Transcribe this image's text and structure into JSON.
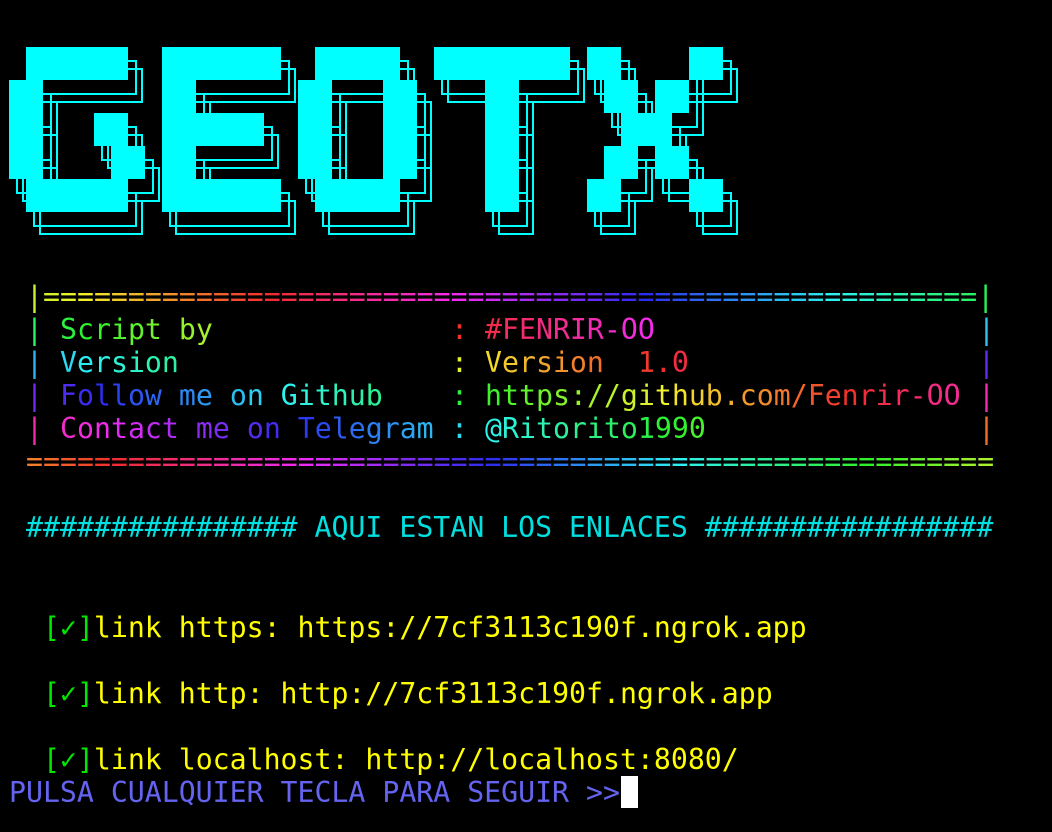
{
  "logo": {
    "text": "GEOTX",
    "color": "#00FFFF"
  },
  "box": {
    "border_top": "|=======================================================|",
    "border_bottom": "=========================================================",
    "side": "|",
    "colon": ":",
    "rows": [
      {
        "label": "Script by",
        "value": "#FENRIR-OO"
      },
      {
        "label": "Version",
        "value": "Version  1.0"
      },
      {
        "label": "Follow me on Github",
        "value": "https://github.com/Fenrir-OO"
      },
      {
        "label": "Contact me on Telegram",
        "value": "@Ritorito1990"
      }
    ]
  },
  "header": "################ AQUI ESTAN LOS ENLACES #################",
  "links": [
    {
      "mark": "[✓]",
      "text": "link https: https://7cf3113c190f.ngrok.app"
    },
    {
      "mark": "[✓]",
      "text": "link http: http://7cf3113c190f.ngrok.app"
    },
    {
      "mark": "[✓]",
      "text": "link localhost: http://localhost:8080/"
    }
  ],
  "prompt": "PULSA CUALQUIER TECLA PARA SEGUIR >>",
  "colors": {
    "header": "#00e0e0",
    "check": "#00e800",
    "link": "#ffff00",
    "prompt": "#6464f0",
    "cursor": "#ffffff"
  }
}
